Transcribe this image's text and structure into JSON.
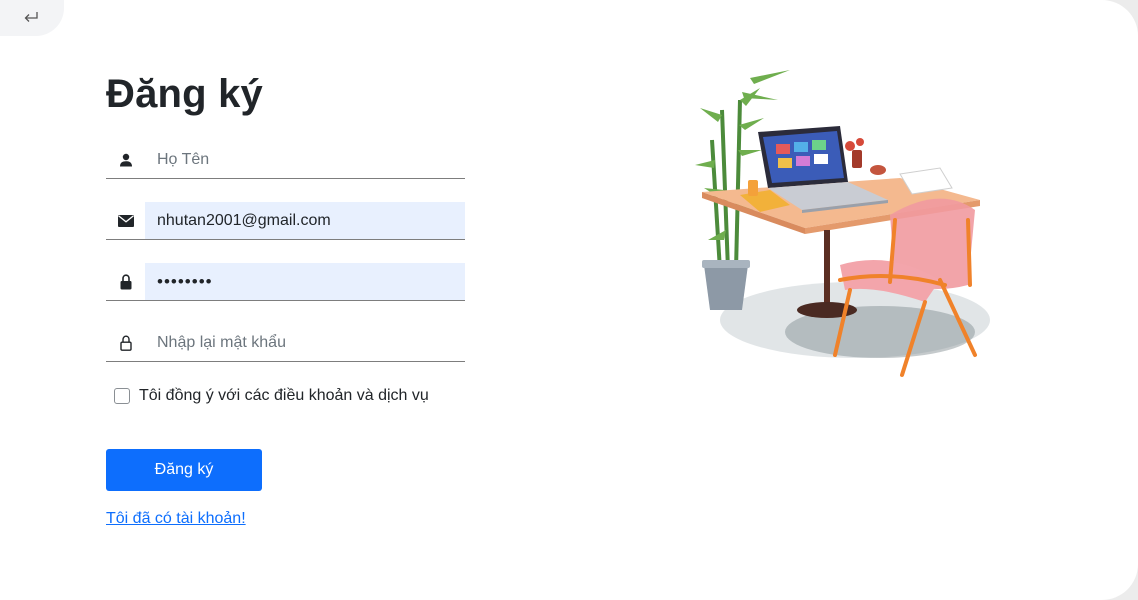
{
  "page": {
    "title": "Đăng ký"
  },
  "back_button": {
    "icon": "return-arrow-icon"
  },
  "form": {
    "name": {
      "placeholder": "Họ Tên",
      "value": "",
      "icon": "user-icon"
    },
    "email": {
      "placeholder": "",
      "value": "nhutan2001@gmail.com",
      "icon": "envelope-icon"
    },
    "password": {
      "placeholder": "",
      "value": "••••••••",
      "icon": "lock-filled-icon"
    },
    "confirm_password": {
      "placeholder": "Nhập lại mật khẩu",
      "value": "",
      "icon": "lock-outline-icon"
    },
    "agree": {
      "label": "Tôi đồng ý với các điều khoản và dịch vụ",
      "checked": false
    },
    "submit_label": "Đăng ký",
    "login_link": "Tôi đã có tài khoản!"
  },
  "colors": {
    "primary": "#0d6efd",
    "autofill_bg": "#e8f0fe",
    "text": "#212529"
  }
}
